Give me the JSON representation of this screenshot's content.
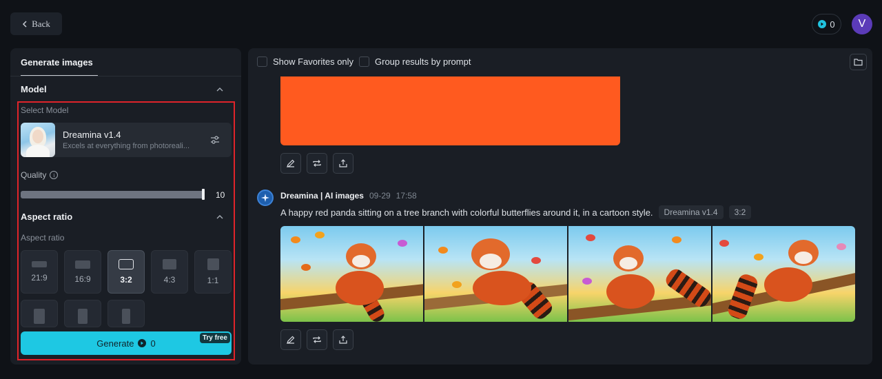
{
  "header": {
    "back_label": "Back",
    "credits": "0",
    "avatar_letter": "V"
  },
  "left_panel": {
    "tab_label": "Generate images",
    "model_section": "Model",
    "select_model_label": "Select Model",
    "model_name": "Dreamina v1.4",
    "model_desc": "Excels at everything from photoreali...",
    "quality_label": "Quality",
    "quality_value": "10",
    "aspect_section": "Aspect ratio",
    "aspect_label": "Aspect ratio",
    "ratios": [
      "21:9",
      "16:9",
      "3:2",
      "4:3",
      "1:1"
    ],
    "selected_ratio": "3:2",
    "generate_label": "Generate",
    "generate_cost": "0",
    "try_free": "Try free"
  },
  "right_panel": {
    "show_favorites": "Show Favorites only",
    "group_results": "Group results by prompt",
    "sender": "Dreamina | AI images",
    "date": "09-29",
    "time": "17:58",
    "prompt": "A happy red panda sitting on a tree branch with colorful butterflies around it, in a cartoon style.",
    "model_tag": "Dreamina v1.4",
    "ratio_tag": "3:2"
  },
  "colors": {
    "accent": "#1ec8e3",
    "highlight_border": "#e0242a",
    "avatar": "#5b3bb8",
    "orange_image": "#ff5a1f"
  }
}
